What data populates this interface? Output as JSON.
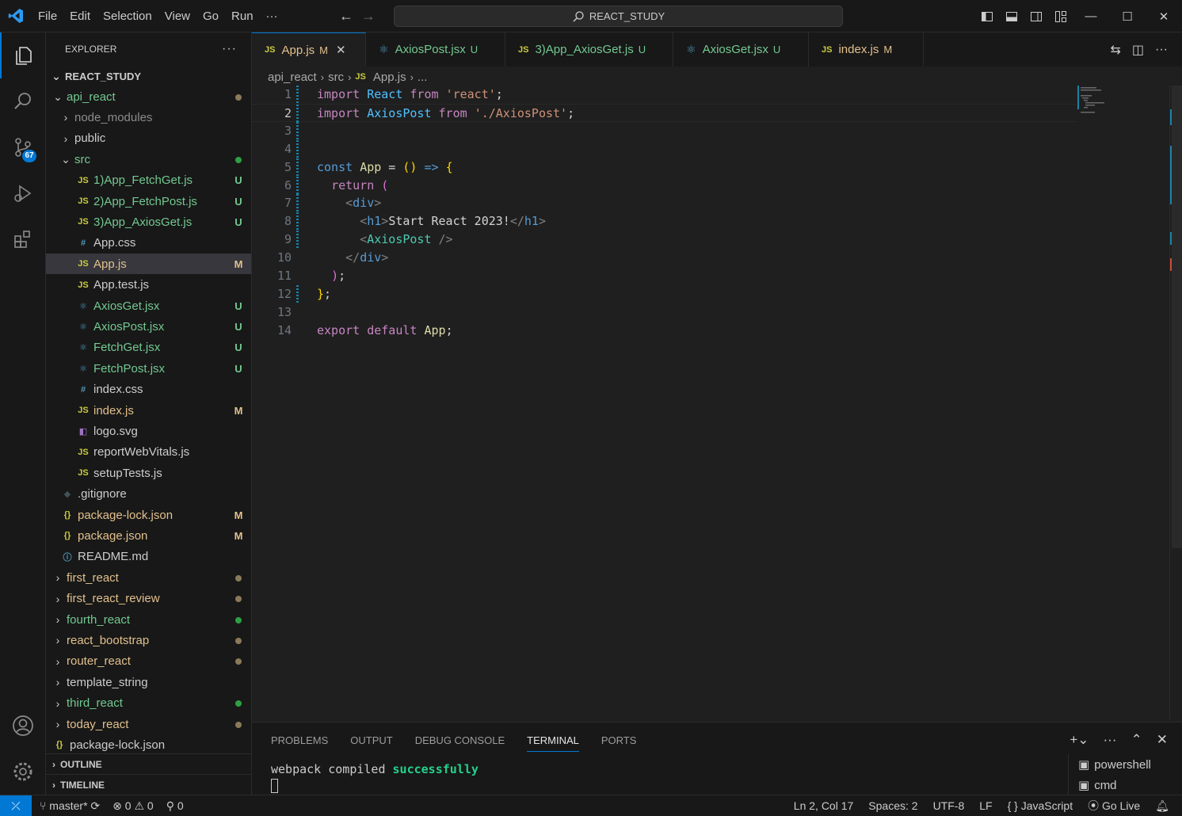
{
  "menu": [
    "File",
    "Edit",
    "Selection",
    "View",
    "Go",
    "Run",
    "···"
  ],
  "search": {
    "text": "REACT_STUDY"
  },
  "explorer": {
    "title": "EXPLORER",
    "workspace": "REACT_STUDY",
    "rows": [
      {
        "name": "api_react",
        "kind": "folder-open",
        "depth": 1,
        "color": "#73c991",
        "status": "dot",
        "statusColor": "#8a7a5a"
      },
      {
        "name": "node_modules",
        "kind": "folder",
        "depth": 2,
        "color": "#8c8c8c",
        "status": ""
      },
      {
        "name": "public",
        "kind": "folder",
        "depth": 2,
        "color": "#cccccc",
        "status": ""
      },
      {
        "name": "src",
        "kind": "folder-open",
        "depth": 2,
        "color": "#73c991",
        "status": "dot",
        "statusColor": "#2ea043"
      },
      {
        "name": "1)App_FetchGet.js",
        "kind": "js",
        "depth": 3,
        "color": "#73c991",
        "status": "U",
        "statusColor": "#73c991"
      },
      {
        "name": "2)App_FetchPost.js",
        "kind": "js",
        "depth": 3,
        "color": "#73c991",
        "status": "U",
        "statusColor": "#73c991"
      },
      {
        "name": "3)App_AxiosGet.js",
        "kind": "js",
        "depth": 3,
        "color": "#73c991",
        "status": "U",
        "statusColor": "#73c991"
      },
      {
        "name": "App.css",
        "kind": "css",
        "depth": 3,
        "color": "#cccccc",
        "status": ""
      },
      {
        "name": "App.js",
        "kind": "js",
        "depth": 3,
        "color": "#e2c08d",
        "status": "M",
        "statusColor": "#e2c08d",
        "selected": true
      },
      {
        "name": "App.test.js",
        "kind": "js",
        "depth": 3,
        "color": "#cccccc",
        "status": ""
      },
      {
        "name": "AxiosGet.jsx",
        "kind": "react",
        "depth": 3,
        "color": "#73c991",
        "status": "U",
        "statusColor": "#73c991"
      },
      {
        "name": "AxiosPost.jsx",
        "kind": "react",
        "depth": 3,
        "color": "#73c991",
        "status": "U",
        "statusColor": "#73c991"
      },
      {
        "name": "FetchGet.jsx",
        "kind": "react",
        "depth": 3,
        "color": "#73c991",
        "status": "U",
        "statusColor": "#73c991"
      },
      {
        "name": "FetchPost.jsx",
        "kind": "react",
        "depth": 3,
        "color": "#73c991",
        "status": "U",
        "statusColor": "#73c991"
      },
      {
        "name": "index.css",
        "kind": "css",
        "depth": 3,
        "color": "#cccccc",
        "status": ""
      },
      {
        "name": "index.js",
        "kind": "js",
        "depth": 3,
        "color": "#e2c08d",
        "status": "M",
        "statusColor": "#e2c08d"
      },
      {
        "name": "logo.svg",
        "kind": "svg",
        "depth": 3,
        "color": "#cccccc",
        "status": ""
      },
      {
        "name": "reportWebVitals.js",
        "kind": "js",
        "depth": 3,
        "color": "#cccccc",
        "status": ""
      },
      {
        "name": "setupTests.js",
        "kind": "js",
        "depth": 3,
        "color": "#cccccc",
        "status": ""
      },
      {
        "name": ".gitignore",
        "kind": "git",
        "depth": 2,
        "color": "#cccccc",
        "status": ""
      },
      {
        "name": "package-lock.json",
        "kind": "json",
        "depth": 2,
        "color": "#e2c08d",
        "status": "M",
        "statusColor": "#e2c08d"
      },
      {
        "name": "package.json",
        "kind": "json",
        "depth": 2,
        "color": "#e2c08d",
        "status": "M",
        "statusColor": "#e2c08d"
      },
      {
        "name": "README.md",
        "kind": "info",
        "depth": 2,
        "color": "#cccccc",
        "status": ""
      },
      {
        "name": "first_react",
        "kind": "folder",
        "depth": 1,
        "color": "#e2c08d",
        "status": "dot",
        "statusColor": "#8a7a5a"
      },
      {
        "name": "first_react_review",
        "kind": "folder",
        "depth": 1,
        "color": "#e2c08d",
        "status": "dot",
        "statusColor": "#8a7a5a"
      },
      {
        "name": "fourth_react",
        "kind": "folder",
        "depth": 1,
        "color": "#73c991",
        "status": "dot",
        "statusColor": "#2ea043"
      },
      {
        "name": "react_bootstrap",
        "kind": "folder",
        "depth": 1,
        "color": "#e2c08d",
        "status": "dot",
        "statusColor": "#8a7a5a"
      },
      {
        "name": "router_react",
        "kind": "folder",
        "depth": 1,
        "color": "#e2c08d",
        "status": "dot",
        "statusColor": "#8a7a5a"
      },
      {
        "name": "template_string",
        "kind": "folder",
        "depth": 1,
        "color": "#cccccc",
        "status": ""
      },
      {
        "name": "third_react",
        "kind": "folder",
        "depth": 1,
        "color": "#73c991",
        "status": "dot",
        "statusColor": "#2ea043"
      },
      {
        "name": "today_react",
        "kind": "folder",
        "depth": 1,
        "color": "#e2c08d",
        "status": "dot",
        "statusColor": "#8a7a5a"
      },
      {
        "name": "package-lock.json",
        "kind": "json",
        "depth": 1,
        "color": "#cccccc",
        "status": ""
      }
    ],
    "outline": "OUTLINE",
    "timeline": "TIMELINE"
  },
  "tabs": [
    {
      "icon": "JS",
      "label": "App.js",
      "status": "M",
      "color": "#e2c08d",
      "active": true,
      "kind": "js"
    },
    {
      "icon": "react",
      "label": "AxiosPost.jsx",
      "status": "U",
      "color": "#73c991",
      "kind": "react"
    },
    {
      "icon": "JS",
      "label": "3)App_AxiosGet.js",
      "status": "U",
      "color": "#73c991",
      "kind": "js"
    },
    {
      "icon": "react",
      "label": "AxiosGet.jsx",
      "status": "U",
      "color": "#73c991",
      "kind": "react"
    },
    {
      "icon": "JS",
      "label": "index.js",
      "status": "M",
      "color": "#e2c08d",
      "kind": "js"
    }
  ],
  "breadcrumb": [
    "api_react",
    "src",
    "App.js",
    "..."
  ],
  "code": [
    [
      [
        "kw",
        "import"
      ],
      [
        "pn",
        " "
      ],
      [
        "vr",
        "React"
      ],
      [
        "pn",
        " "
      ],
      [
        "kw",
        "from"
      ],
      [
        "pn",
        " "
      ],
      [
        "st",
        "'react'"
      ],
      [
        "pn",
        ";"
      ]
    ],
    [
      [
        "kw",
        "import"
      ],
      [
        "pn",
        " "
      ],
      [
        "vr",
        "AxiosPost"
      ],
      [
        "pn",
        " "
      ],
      [
        "kw",
        "from"
      ],
      [
        "pn",
        " "
      ],
      [
        "st",
        "'./AxiosPost'"
      ],
      [
        "pn",
        ";"
      ]
    ],
    [],
    [],
    [
      [
        "kb",
        "const"
      ],
      [
        "pn",
        " "
      ],
      [
        "fn",
        "App"
      ],
      [
        "pn",
        " = "
      ],
      [
        "br1",
        "()"
      ],
      [
        "pn",
        " "
      ],
      [
        "kb",
        "=>"
      ],
      [
        "pn",
        " "
      ],
      [
        "br1",
        "{"
      ]
    ],
    [
      [
        "pn",
        "  "
      ],
      [
        "kw",
        "return"
      ],
      [
        "pn",
        " "
      ],
      [
        "br2",
        "("
      ]
    ],
    [
      [
        "pn",
        "    "
      ],
      [
        "tgb",
        "<"
      ],
      [
        "tg",
        "div"
      ],
      [
        "tgb",
        ">"
      ]
    ],
    [
      [
        "pn",
        "      "
      ],
      [
        "tgb",
        "<"
      ],
      [
        "tg",
        "h1"
      ],
      [
        "tgb",
        ">"
      ],
      [
        "pn",
        "Start React 2023!"
      ],
      [
        "tgb",
        "</"
      ],
      [
        "tg",
        "h1"
      ],
      [
        "tgb",
        ">"
      ]
    ],
    [
      [
        "pn",
        "      "
      ],
      [
        "tgb",
        "<"
      ],
      [
        "cm",
        "AxiosPost"
      ],
      [
        "pn",
        " "
      ],
      [
        "tgb",
        "/>"
      ]
    ],
    [
      [
        "pn",
        "    "
      ],
      [
        "tgb",
        "</"
      ],
      [
        "tg",
        "div"
      ],
      [
        "tgb",
        ">"
      ]
    ],
    [
      [
        "pn",
        "  "
      ],
      [
        "br2",
        ")"
      ],
      [
        "pn",
        ";"
      ]
    ],
    [
      [
        "br1",
        "}"
      ],
      [
        "pn",
        ";"
      ]
    ],
    [],
    [
      [
        "kw",
        "export"
      ],
      [
        "pn",
        " "
      ],
      [
        "kw",
        "default"
      ],
      [
        "pn",
        " "
      ],
      [
        "fn",
        "App"
      ],
      [
        "pn",
        ";"
      ]
    ]
  ],
  "gutter_modified": [
    1,
    2,
    3,
    4,
    5,
    6,
    7,
    8,
    9,
    12
  ],
  "current_line": 2,
  "panel": {
    "tabs": [
      "PROBLEMS",
      "OUTPUT",
      "DEBUG CONSOLE",
      "TERMINAL",
      "PORTS"
    ],
    "active": "TERMINAL",
    "terminal_text": "webpack compiled ",
    "terminal_ok": "successfully",
    "terminals": [
      "powershell",
      "cmd"
    ]
  },
  "status": {
    "branch": "master*",
    "errors": "0",
    "warnings": "0",
    "ports": "0",
    "position": "Ln 2, Col 17",
    "spaces": "Spaces: 2",
    "encoding": "UTF-8",
    "eol": "LF",
    "language": "JavaScript",
    "golive": "Go Live"
  },
  "scm_badge": "67"
}
